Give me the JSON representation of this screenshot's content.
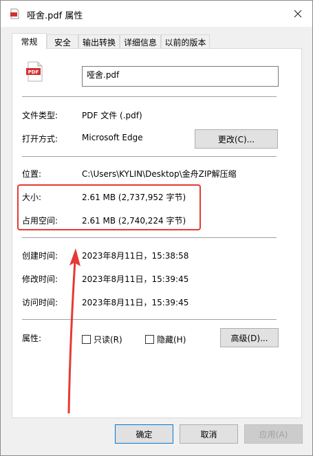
{
  "window": {
    "title": "哑舍.pdf 属性"
  },
  "tabs": [
    {
      "label": "常规"
    },
    {
      "label": "安全"
    },
    {
      "label": "输出转换"
    },
    {
      "label": "详细信息"
    },
    {
      "label": "以前的版本"
    }
  ],
  "file": {
    "name": "哑舍.pdf",
    "icon_text": "PDF"
  },
  "props": {
    "type_label": "文件类型:",
    "type_value": "PDF 文件 (.pdf)",
    "open_label": "打开方式:",
    "open_value": "Microsoft Edge",
    "change_button": "更改(C)...",
    "location_label": "位置:",
    "location_value": "C:\\Users\\KYLIN\\Desktop\\金舟ZIP解压缩",
    "size_label": "大小:",
    "size_value": "2.61 MB (2,737,952 字节)",
    "disk_label": "占用空间:",
    "disk_value": "2.61 MB (2,740,224 字节)",
    "created_label": "创建时间:",
    "created_value": "2023年8月11日，15:38:58",
    "modified_label": "修改时间:",
    "modified_value": "2023年8月11日，15:39:45",
    "accessed_label": "访问时间:",
    "accessed_value": "2023年8月11日，15:39:45",
    "attr_label": "属性:",
    "readonly_label": "只读(R)",
    "hidden_label": "隐藏(H)",
    "advanced_button": "高级(D)..."
  },
  "footer": {
    "ok": "确定",
    "cancel": "取消",
    "apply": "应用(A)"
  },
  "colors": {
    "highlight": "#e53935",
    "pdf_red": "#d32f2f"
  }
}
